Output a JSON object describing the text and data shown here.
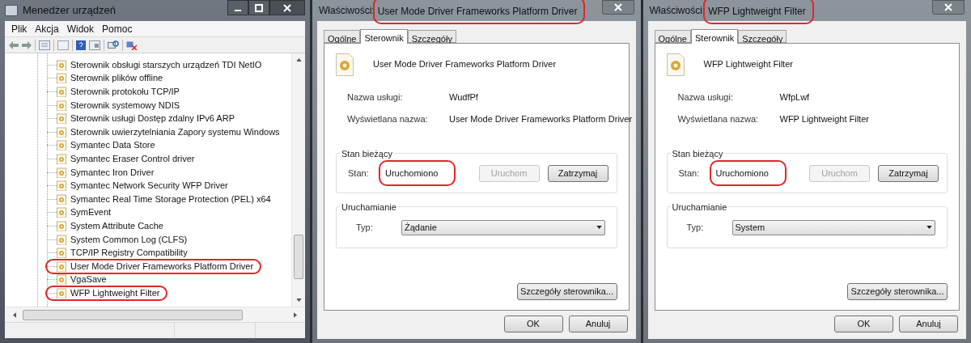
{
  "device_manager": {
    "title": "Menedżer urządzeń",
    "menu": [
      "Plik",
      "Akcja",
      "Widok",
      "Pomoc"
    ],
    "tree_items": [
      {
        "label": "Sterownik obsługi starszych urządzeń TDI NetIO",
        "highlighted": false
      },
      {
        "label": "Sterownik plików offline",
        "highlighted": false
      },
      {
        "label": "Sterownik protokołu TCP/IP",
        "highlighted": false
      },
      {
        "label": "Sterownik systemowy NDIS",
        "highlighted": false
      },
      {
        "label": "Sterownik usługi Dostęp zdalny IPv6 ARP",
        "highlighted": false
      },
      {
        "label": "Sterownik uwierzytelniania Zapory systemu Windows",
        "highlighted": false
      },
      {
        "label": "Symantec Data Store",
        "highlighted": false
      },
      {
        "label": "Symantec Eraser Control driver",
        "highlighted": false
      },
      {
        "label": "Symantec Iron Driver",
        "highlighted": false
      },
      {
        "label": "Symantec Network Security WFP Driver",
        "highlighted": false
      },
      {
        "label": "Symantec Real Time Storage Protection (PEL) x64",
        "highlighted": false
      },
      {
        "label": "SymEvent",
        "highlighted": false
      },
      {
        "label": "System Attribute Cache",
        "highlighted": false
      },
      {
        "label": "System Common Log (CLFS)",
        "highlighted": false
      },
      {
        "label": "TCP/IP Registry Compatibility",
        "highlighted": false
      },
      {
        "label": "User Mode Driver Frameworks Platform Driver",
        "highlighted": true
      },
      {
        "label": "VgaSave",
        "highlighted": false
      },
      {
        "label": "WFP Lightweight Filter",
        "highlighted": true
      }
    ]
  },
  "dialogs": [
    {
      "title_prefix": "Właściwości:",
      "title_name": "User Mode Driver Frameworks Platform Driver",
      "title_highlighted": true,
      "tabs": [
        {
          "label": "Ogólne",
          "selected": false
        },
        {
          "label": "Sterownik",
          "selected": true
        },
        {
          "label": "Szczegóły",
          "selected": false
        }
      ],
      "driver_name": "User Mode Driver Frameworks Platform Driver",
      "fields": [
        {
          "label": "Nazwa usługi:",
          "value": "WudfPf"
        },
        {
          "label": "Wyświetlana nazwa:",
          "value": "User Mode Driver Frameworks Platform Driver"
        }
      ],
      "status_group": {
        "title": "Stan bieżący",
        "label": "Stan:",
        "value": "Uruchomiono",
        "highlighted": true,
        "buttons": [
          {
            "label": "Uruchom",
            "disabled": true
          },
          {
            "label": "Zatrzymaj",
            "disabled": false
          }
        ]
      },
      "startup_group": {
        "title": "Uruchamianie",
        "label": "Typ:",
        "value": "Żądanie"
      },
      "details_button": "Szczegóły sterownika...",
      "buttons": [
        "OK",
        "Anuluj"
      ]
    },
    {
      "title_prefix": "Właściwości:",
      "title_name": "WFP Lightweight Filter",
      "title_highlighted": true,
      "tabs": [
        {
          "label": "Ogólne",
          "selected": false
        },
        {
          "label": "Sterownik",
          "selected": true
        },
        {
          "label": "Szczegóły",
          "selected": false
        }
      ],
      "driver_name": "WFP Lightweight Filter",
      "fields": [
        {
          "label": "Nazwa usługi:",
          "value": "WfpLwf"
        },
        {
          "label": "Wyświetlana nazwa:",
          "value": "WFP Lightweight Filter"
        }
      ],
      "status_group": {
        "title": "Stan bieżący",
        "label": "Stan:",
        "value": "Uruchomiono",
        "highlighted": true,
        "buttons": [
          {
            "label": "Uruchom",
            "disabled": true
          },
          {
            "label": "Zatrzymaj",
            "disabled": false
          }
        ]
      },
      "startup_group": {
        "title": "Uruchamianie",
        "label": "Typ:",
        "value": "System"
      },
      "details_button": "Szczegóły sterownika...",
      "buttons": [
        "OK",
        "Anuluj"
      ]
    }
  ]
}
